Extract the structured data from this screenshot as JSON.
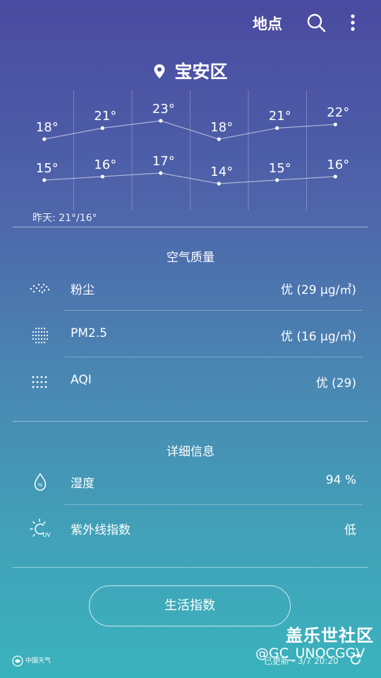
{
  "header": {
    "title": "地点",
    "location_name": "宝安区"
  },
  "forecast": {
    "highs": [
      "18°",
      "21°",
      "23°",
      "18°",
      "21°",
      "22°"
    ],
    "lows": [
      "15°",
      "16°",
      "17°",
      "14°",
      "15°",
      "16°"
    ],
    "yesterday": "昨天: 21°/16°"
  },
  "air_quality": {
    "title": "空气质量",
    "items": [
      {
        "label": "粉尘",
        "value": "优 (29 μg/㎥)"
      },
      {
        "label": "PM2.5",
        "value": "优 (16 μg/㎥)"
      },
      {
        "label": "AQI",
        "value": "优 (29)"
      }
    ]
  },
  "details": {
    "title": "详细信息",
    "items": [
      {
        "label": "湿度",
        "value": "94 %"
      },
      {
        "label": "紫外线指数",
        "value": "低"
      }
    ]
  },
  "life_button": "生活指数",
  "footer": {
    "logo_text": "中国天气",
    "updated": "已更新 - 3/7 20:20",
    "watermark_title": "盖乐世社区",
    "watermark_user": "@GC_UNOCGGV"
  }
}
